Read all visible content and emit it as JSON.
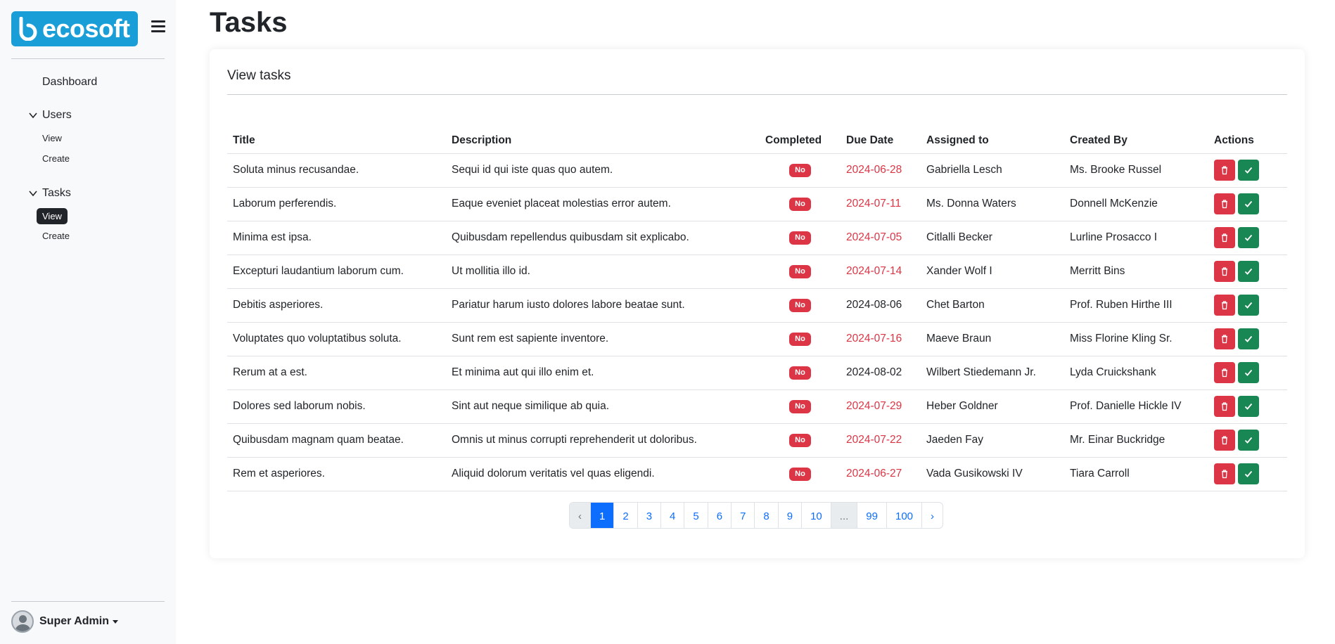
{
  "brand": {
    "name": "ecosoft"
  },
  "sidebar": {
    "dashboard": "Dashboard",
    "groups": [
      {
        "label": "Users",
        "items": [
          "View",
          "Create"
        ]
      },
      {
        "label": "Tasks",
        "items": [
          "View",
          "Create"
        ],
        "active_item": "View"
      }
    ],
    "user": "Super Admin"
  },
  "page": {
    "title": "Tasks",
    "card_title": "View tasks"
  },
  "table": {
    "columns": [
      "Title",
      "Description",
      "Completed",
      "Due Date",
      "Assigned to",
      "Created By",
      "Actions"
    ],
    "rows": [
      {
        "title": "Soluta minus recusandae.",
        "description": "Sequi id qui iste quas quo autem.",
        "completed": "No",
        "due": "2024-06-28",
        "overdue": true,
        "assigned": "Gabriella Lesch",
        "created_by": "Ms. Brooke Russel"
      },
      {
        "title": "Laborum perferendis.",
        "description": "Eaque eveniet placeat molestias error autem.",
        "completed": "No",
        "due": "2024-07-11",
        "overdue": true,
        "assigned": "Ms. Donna Waters",
        "created_by": "Donnell McKenzie"
      },
      {
        "title": "Minima est ipsa.",
        "description": "Quibusdam repellendus quibusdam sit explicabo.",
        "completed": "No",
        "due": "2024-07-05",
        "overdue": true,
        "assigned": "Citlalli Becker",
        "created_by": "Lurline Prosacco I"
      },
      {
        "title": "Excepturi laudantium laborum cum.",
        "description": "Ut mollitia illo id.",
        "completed": "No",
        "due": "2024-07-14",
        "overdue": true,
        "assigned": "Xander Wolf I",
        "created_by": "Merritt Bins"
      },
      {
        "title": "Debitis asperiores.",
        "description": "Pariatur harum iusto dolores labore beatae sunt.",
        "completed": "No",
        "due": "2024-08-06",
        "overdue": false,
        "assigned": "Chet Barton",
        "created_by": "Prof. Ruben Hirthe III"
      },
      {
        "title": "Voluptates quo voluptatibus soluta.",
        "description": "Sunt rem est sapiente inventore.",
        "completed": "No",
        "due": "2024-07-16",
        "overdue": true,
        "assigned": "Maeve Braun",
        "created_by": "Miss Florine Kling Sr."
      },
      {
        "title": "Rerum at a est.",
        "description": "Et minima aut qui illo enim et.",
        "completed": "No",
        "due": "2024-08-02",
        "overdue": false,
        "assigned": "Wilbert Stiedemann Jr.",
        "created_by": "Lyda Cruickshank"
      },
      {
        "title": "Dolores sed laborum nobis.",
        "description": "Sint aut neque similique ab quia.",
        "completed": "No",
        "due": "2024-07-29",
        "overdue": true,
        "assigned": "Heber Goldner",
        "created_by": "Prof. Danielle Hickle IV"
      },
      {
        "title": "Quibusdam magnam quam beatae.",
        "description": "Omnis ut minus corrupti reprehenderit ut doloribus.",
        "completed": "No",
        "due": "2024-07-22",
        "overdue": true,
        "assigned": "Jaeden Fay",
        "created_by": "Mr. Einar Buckridge"
      },
      {
        "title": "Rem et asperiores.",
        "description": "Aliquid dolorum veritatis vel quas eligendi.",
        "completed": "No",
        "due": "2024-06-27",
        "overdue": true,
        "assigned": "Vada Gusikowski IV",
        "created_by": "Tiara Carroll"
      }
    ]
  },
  "pagination": {
    "prev": "‹",
    "pages": [
      "1",
      "2",
      "3",
      "4",
      "5",
      "6",
      "7",
      "8",
      "9",
      "10",
      "...",
      "99",
      "100"
    ],
    "active": "1",
    "next": "›"
  },
  "colors": {
    "brand": "#1a9ed8",
    "danger": "#dc3545",
    "success": "#198754",
    "primary": "#0d6efd"
  },
  "icons": {
    "delete": "trash-icon",
    "complete": "check-icon",
    "menu": "hamburger-icon",
    "expand": "chevron-down-icon"
  }
}
